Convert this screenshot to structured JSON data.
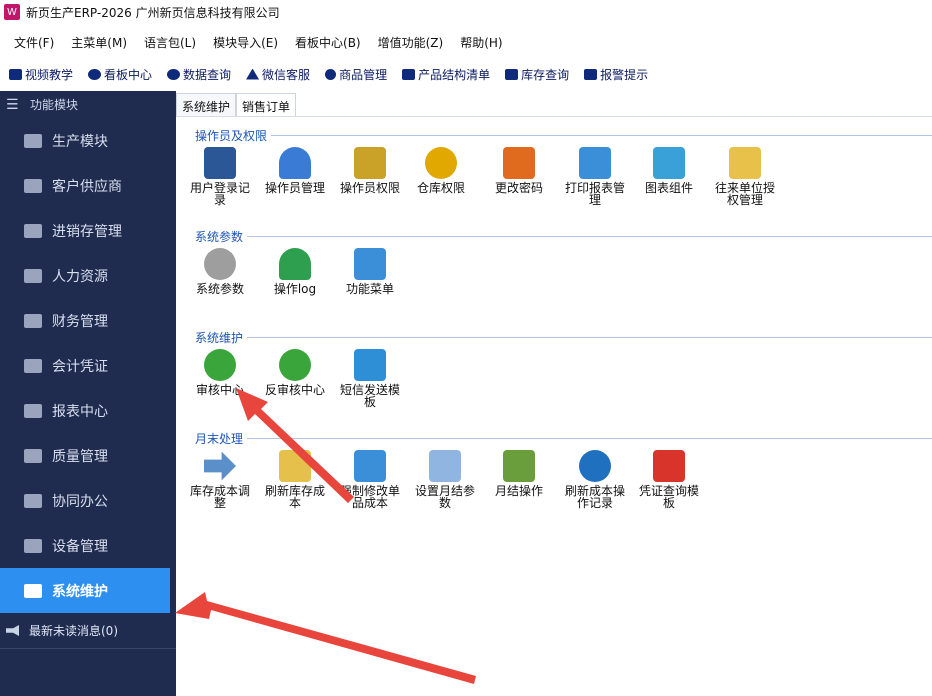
{
  "window": {
    "title": "新页生产ERP-2026 广州新页信息科技有限公司",
    "logo_glyph": "W"
  },
  "menubar": [
    "文件(F)",
    "主菜单(M)",
    "语言包(L)",
    "模块导入(E)",
    "看板中心(B)",
    "增值功能(Z)",
    "帮助(H)"
  ],
  "toolbar": [
    {
      "label": "视频教学",
      "icon": "video-icon"
    },
    {
      "label": "看板中心",
      "icon": "dashboard-icon"
    },
    {
      "label": "数据查询",
      "icon": "chat-icon"
    },
    {
      "label": "微信客服",
      "icon": "warning-icon"
    },
    {
      "label": "商品管理",
      "icon": "search-icon"
    },
    {
      "label": "产品结构清单",
      "icon": "camera-icon"
    },
    {
      "label": "库存查询",
      "icon": "sitemap-icon"
    },
    {
      "label": "报警提示",
      "icon": "list-icon"
    }
  ],
  "sidebar": {
    "header": "功能模块",
    "items": [
      {
        "label": "生产模块",
        "icon": "book-icon"
      },
      {
        "label": "客户供应商",
        "icon": "users-icon"
      },
      {
        "label": "进销存管理",
        "icon": "cart-icon"
      },
      {
        "label": "人力资源",
        "icon": "id-card-icon"
      },
      {
        "label": "财务管理",
        "icon": "coins-icon"
      },
      {
        "label": "会计凭证",
        "icon": "stamp-icon"
      },
      {
        "label": "报表中心",
        "icon": "chart-icon"
      },
      {
        "label": "质量管理",
        "icon": "grid-icon"
      },
      {
        "label": "协同办公",
        "icon": "briefcase-icon"
      },
      {
        "label": "设备管理",
        "icon": "tools-icon"
      },
      {
        "label": "系统维护",
        "icon": "gears-icon",
        "active": true
      }
    ],
    "notice": "最新未读消息(0)"
  },
  "tabs": [
    {
      "label": "系统维护",
      "active": true
    },
    {
      "label": "销售订单",
      "active": false
    }
  ],
  "sections": [
    {
      "title": "操作员及权限",
      "items": [
        {
          "label": "用户登录记录",
          "icon": "login-book-icon",
          "color": "#2b5797"
        },
        {
          "label": "操作员管理",
          "icon": "operator-icon",
          "color": "#3a7bd5"
        },
        {
          "label": "操作员权限",
          "icon": "lock-icon",
          "color": "#c9a227"
        },
        {
          "label": "仓库权限",
          "icon": "key-icon",
          "color": "#e0a800"
        },
        {
          "label": "更改密码",
          "icon": "pencil-tools-icon",
          "color": "#e06b1f"
        },
        {
          "label": "打印报表管理",
          "icon": "database-icon",
          "color": "#3b8fd9"
        },
        {
          "label": "图表组件",
          "icon": "download-doc-icon",
          "color": "#3aa0d8"
        },
        {
          "label": "往来单位授权管理",
          "icon": "folder-doc-icon",
          "color": "#e8c14a"
        }
      ]
    },
    {
      "title": "系统参数",
      "items": [
        {
          "label": "系统参数",
          "icon": "gear-icon",
          "color": "#9e9e9e"
        },
        {
          "label": "操作log",
          "icon": "user-check-icon",
          "color": "#2e9e4f"
        },
        {
          "label": "功能菜单",
          "icon": "database-icon",
          "color": "#3b8fd9"
        }
      ]
    },
    {
      "title": "系统维护",
      "items": [
        {
          "label": "审核中心",
          "icon": "check-circle-icon",
          "color": "#3aa53a"
        },
        {
          "label": "反审核中心",
          "icon": "x-circle-icon",
          "color": "#3aa53a"
        },
        {
          "label": "短信发送模板",
          "icon": "rss-icon",
          "color": "#2f8fd6"
        }
      ]
    },
    {
      "title": "月末处理",
      "items": [
        {
          "label": "库存成本调整",
          "icon": "arrow-right-icon",
          "color": "#5b8fc9"
        },
        {
          "label": "刷新库存成本",
          "icon": "doc-edit-icon",
          "color": "#e5c04a"
        },
        {
          "label": "强制修改单品成本",
          "icon": "squares-icon",
          "color": "#3b8fd9"
        },
        {
          "label": "设置月结参数",
          "icon": "pen-icon",
          "color": "#8fb5e0"
        },
        {
          "label": "月结操作",
          "icon": "screen-check-icon",
          "color": "#6a9e3c"
        },
        {
          "label": "刷新成本操作记录",
          "icon": "p-circle-icon",
          "color": "#2070c0"
        },
        {
          "label": "凭证查询模板",
          "icon": "doc-stop-icon",
          "color": "#d9342b"
        }
      ]
    }
  ],
  "annotation_color": "#e8453c"
}
